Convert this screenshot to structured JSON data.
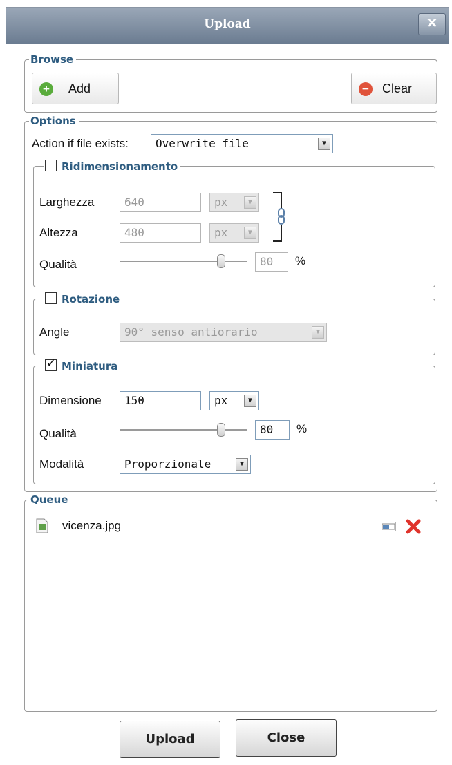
{
  "window": {
    "title": "Upload",
    "close_glyph": "✕"
  },
  "browse": {
    "legend": "Browse",
    "add": {
      "label": "Add",
      "icon": "plus-circle-icon",
      "color": "#5aac3c"
    },
    "clear": {
      "label": "Clear",
      "icon": "minus-circle-icon",
      "color": "#e0533b"
    }
  },
  "options": {
    "legend": "Options",
    "action_label": "Action if file exists:",
    "action_value": "Overwrite file",
    "resize": {
      "legend": "Ridimensionamento",
      "checked": false,
      "width_label": "Larghezza",
      "width_value": "640",
      "width_unit": "px",
      "height_label": "Altezza",
      "height_value": "480",
      "height_unit": "px",
      "quality_label": "Qualità",
      "quality_value": "80",
      "quality_pct": "%",
      "quality_fraction": 0.8
    },
    "rotation": {
      "legend": "Rotazione",
      "checked": false,
      "angle_label": "Angle",
      "angle_value": "90° senso antiorario"
    },
    "thumbnail": {
      "legend": "Miniatura",
      "checked": true,
      "size_label": "Dimensione",
      "size_value": "150",
      "size_unit": "px",
      "quality_label": "Qualità",
      "quality_value": "80",
      "quality_pct": "%",
      "quality_fraction": 0.8,
      "mode_label": "Modalità",
      "mode_value": "Proporzionale"
    }
  },
  "queue": {
    "legend": "Queue",
    "items": [
      {
        "name": "vicenza.jpg",
        "icon": "image-file-icon"
      }
    ]
  },
  "footer": {
    "upload_label": "Upload",
    "close_label": "Close"
  },
  "colors": {
    "legend": "#2e5c80",
    "title_bg": "#7a8a9e",
    "remove": "#e0332b"
  }
}
